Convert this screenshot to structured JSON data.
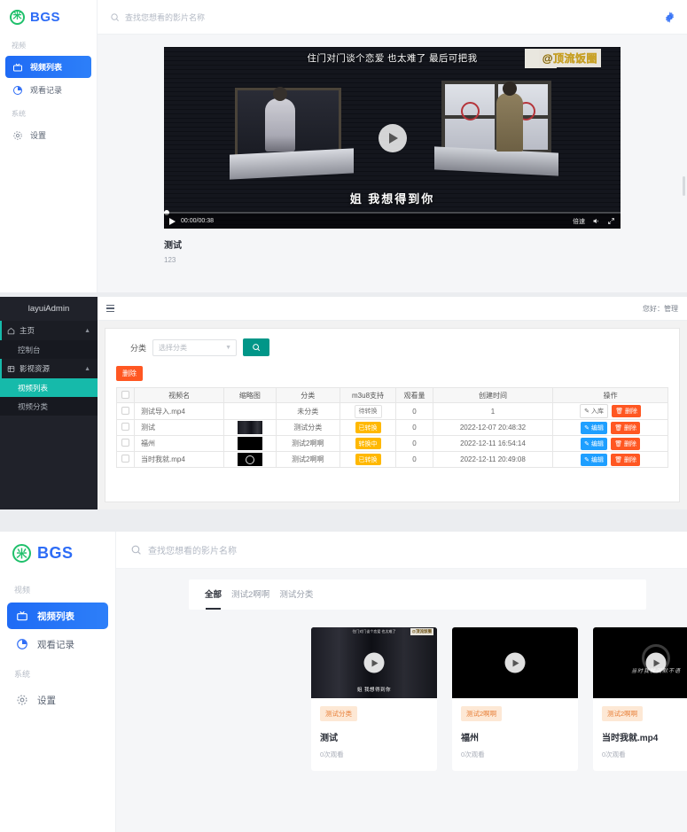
{
  "frontend": {
    "brand": {
      "logo_glyph": "米",
      "name": "BGS"
    },
    "search_placeholder": "查找您想看的影片名称",
    "groups": [
      {
        "title": "视频",
        "items": [
          {
            "label": "视频列表",
            "icon": "tv-icon",
            "active": true
          },
          {
            "label": "观看记录",
            "icon": "history-pie-icon",
            "active": false
          }
        ]
      },
      {
        "title": "系统",
        "items": [
          {
            "label": "设置",
            "icon": "gear-icon",
            "active": false
          }
        ]
      }
    ],
    "settings_icon": "gear-icon"
  },
  "player": {
    "subtitle_top": "住门对门谈个恋爱 也太难了 最后可把我",
    "subtitle_bottom": "姐 我想得到你",
    "watermark": "@顶流饭圈",
    "time": "00:00/00:38",
    "speed_label": "倍速",
    "play_icon": "play-icon",
    "volume_icon": "volume-icon",
    "fullscreen_icon": "fullscreen-icon",
    "title": "测试",
    "description": "123"
  },
  "admin": {
    "logo": "layuiAdmin",
    "menu_icon": "hamburger-icon",
    "hello": "您好：管理",
    "nav": [
      {
        "label": "主页",
        "icon": "home-icon",
        "expanded": true,
        "children": [
          {
            "label": "控制台",
            "active": false
          }
        ]
      },
      {
        "label": "影视资源",
        "icon": "film-icon",
        "expanded": true,
        "children": [
          {
            "label": "视频列表",
            "active": true
          },
          {
            "label": "视频分类",
            "active": false
          }
        ]
      }
    ],
    "filter": {
      "label": "分类",
      "select_placeholder": "选择分类",
      "search_icon": "search-icon"
    },
    "delete_button": "删除",
    "table": {
      "headers": [
        "视频名",
        "缩略图",
        "分类",
        "m3u8支持",
        "观看量",
        "创建时间",
        "操作"
      ],
      "rows": [
        {
          "name": "测试导入.mp4",
          "thumb": "none",
          "category": "未分类",
          "m3u8": "待转换",
          "m3u8_style": "pending",
          "views": "0",
          "created": "1",
          "actions": [
            {
              "label": "入库",
              "style": "white",
              "icon": "pencil-icon"
            },
            {
              "label": "删除",
              "style": "red",
              "icon": "trash-icon"
            }
          ]
        },
        {
          "name": "测试",
          "thumb": "scene",
          "category": "测试分类",
          "m3u8": "已转换",
          "m3u8_style": "warn",
          "views": "0",
          "created": "2022-12-07 20:48:32",
          "actions": [
            {
              "label": "编辑",
              "style": "blue",
              "icon": "pencil-icon"
            },
            {
              "label": "删除",
              "style": "red",
              "icon": "trash-icon"
            }
          ]
        },
        {
          "name": "福州",
          "thumb": "black",
          "category": "测试2啊啊",
          "m3u8": "转换中",
          "m3u8_style": "warn",
          "views": "0",
          "created": "2022-12-11 16:54:14",
          "actions": [
            {
              "label": "编辑",
              "style": "blue",
              "icon": "pencil-icon"
            },
            {
              "label": "删除",
              "style": "red",
              "icon": "trash-icon"
            }
          ]
        },
        {
          "name": "当时我就.mp4",
          "thumb": "ring",
          "category": "测试2啊啊",
          "m3u8": "已转换",
          "m3u8_style": "warn",
          "views": "0",
          "created": "2022-12-11 20:49:08",
          "actions": [
            {
              "label": "编辑",
              "style": "blue",
              "icon": "pencil-icon"
            },
            {
              "label": "删除",
              "style": "red",
              "icon": "trash-icon"
            }
          ]
        }
      ]
    }
  },
  "grid_page": {
    "tabs": [
      {
        "label": "全部",
        "active": true
      },
      {
        "label": "测试2啊啊",
        "active": false
      },
      {
        "label": "测试分类",
        "active": false
      }
    ],
    "cards": [
      {
        "tag": "测试分类",
        "title": "测试",
        "views": "0次观看",
        "thumb": "scene",
        "sub_top": "住门对门谈个恋爱 也太难了",
        "sub_bottom": "姐 我想得到你",
        "watermark": "@顶流饭圈"
      },
      {
        "tag": "测试2啊啊",
        "title": "福州",
        "views": "0次观看",
        "thumb": "black"
      },
      {
        "tag": "测试2啊啊",
        "title": "当时我就.mp4",
        "views": "0次观看",
        "thumb": "ring",
        "art_text": "当时我就沉默不语"
      }
    ]
  },
  "colors": {
    "brand_blue": "#2d6cf6",
    "active_nav": "#1f6bf5",
    "logo_green": "#1fc06b",
    "admin_teal": "#16baaa",
    "admin_search": "#009688",
    "danger": "#ff5722",
    "info": "#1e9fff",
    "warning": "#ffb800",
    "tag_bg": "#fde8d5",
    "tag_fg": "#e8803a"
  }
}
